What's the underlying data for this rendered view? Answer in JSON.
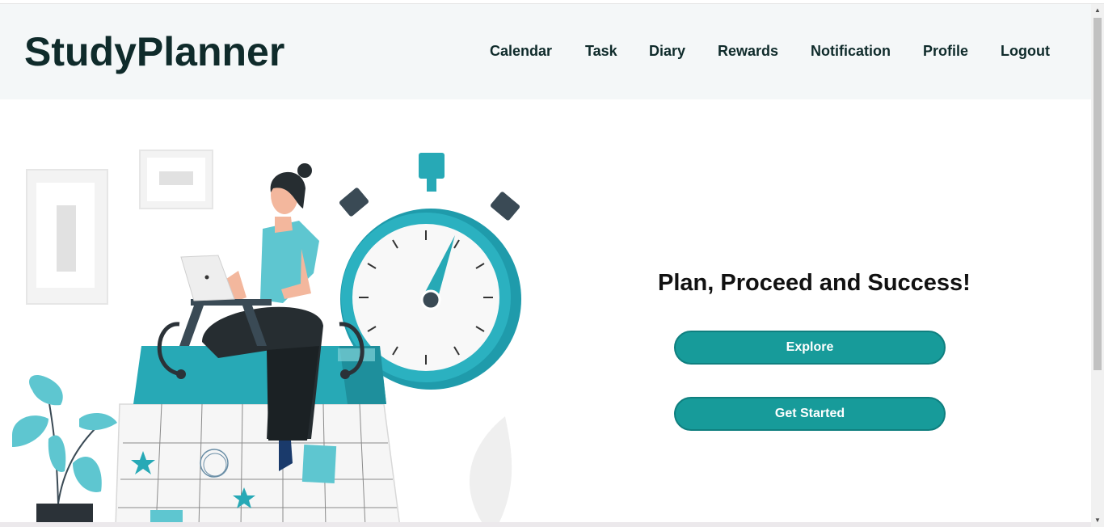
{
  "header": {
    "brand": "StudyPlanner",
    "nav": [
      {
        "label": "Calendar"
      },
      {
        "label": "Task"
      },
      {
        "label": "Diary"
      },
      {
        "label": "Rewards"
      },
      {
        "label": "Notification"
      },
      {
        "label": "Profile"
      },
      {
        "label": "Logout"
      }
    ]
  },
  "hero": {
    "tagline": "Plan, Proceed and Success!",
    "explore_label": "Explore",
    "get_started_label": "Get Started"
  },
  "colors": {
    "accent": "#179b9a",
    "brand_text": "#0f2b2b",
    "header_bg": "#f4f7f8",
    "illustration_teal": "#27a9b6"
  }
}
